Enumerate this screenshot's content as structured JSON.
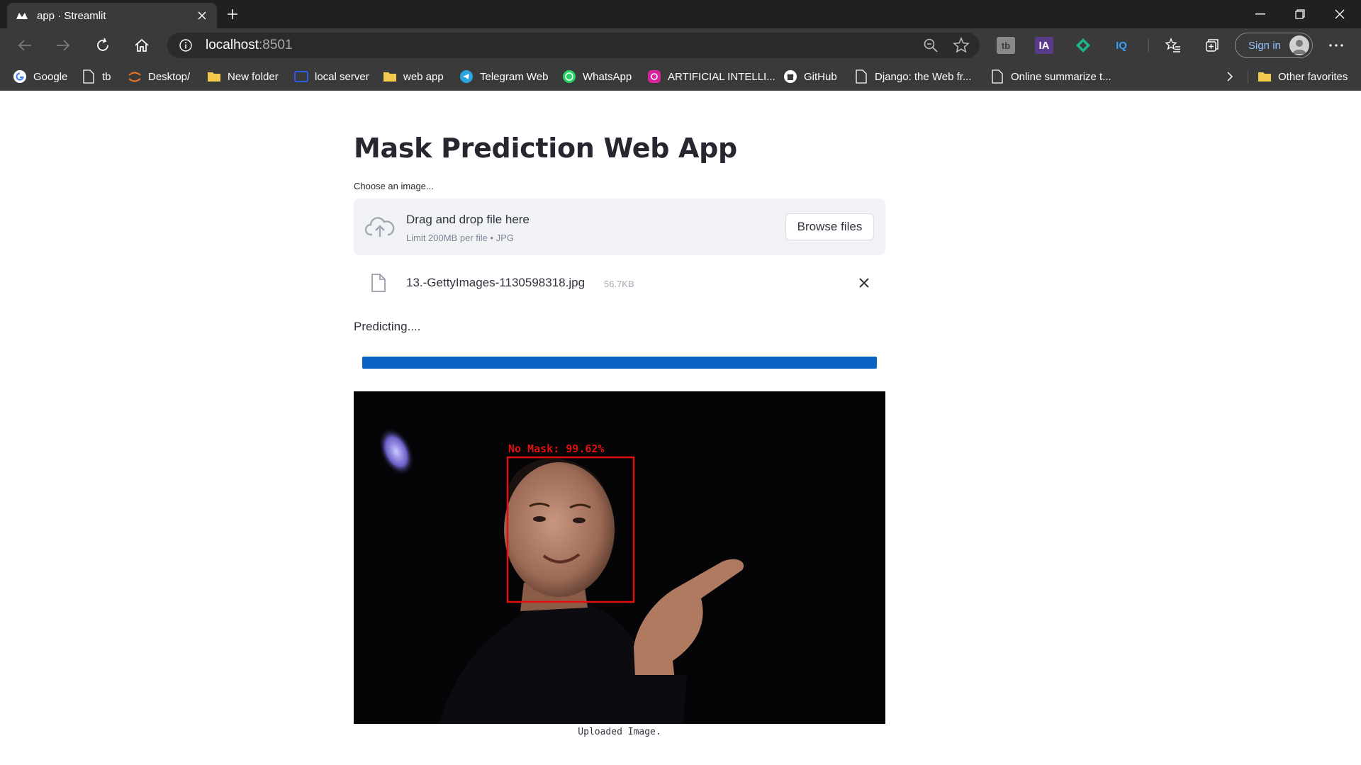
{
  "browser": {
    "tab_title": "app · Streamlit",
    "url_host": "localhost",
    "url_port": ":8501",
    "signin_label": "Sign in",
    "extensions": [
      "tb",
      "IA",
      "IQ"
    ],
    "bookmarks": [
      {
        "label": "Google",
        "icon": "google-icon"
      },
      {
        "label": "tb",
        "icon": "page-icon"
      },
      {
        "label": "Desktop/",
        "icon": "jupyter-icon"
      },
      {
        "label": "New folder",
        "icon": "folder-icon"
      },
      {
        "label": "local server",
        "icon": "server-icon"
      },
      {
        "label": "web app",
        "icon": "folder-icon"
      },
      {
        "label": "Telegram Web",
        "icon": "telegram-icon"
      },
      {
        "label": "WhatsApp",
        "icon": "whatsapp-icon"
      },
      {
        "label": "ARTIFICIAL INTELLI...",
        "icon": "instagram-icon"
      },
      {
        "label": "GitHub",
        "icon": "github-icon"
      },
      {
        "label": "Django: the Web fr...",
        "icon": "page-icon"
      },
      {
        "label": "Online summarize t...",
        "icon": "page-icon"
      }
    ],
    "other_favorites": "Other favorites"
  },
  "app": {
    "title": "Mask Prediction Web App",
    "uploader_label": "Choose an image...",
    "drop_text": "Drag and drop file here",
    "limit_text": "Limit 200MB per file • JPG",
    "browse_label": "Browse files",
    "file_name": "13.-GettyImages-1130598318.jpg",
    "file_size": "56.7KB",
    "status_text": "Predicting....",
    "progress": 1.0,
    "detection_label": "No Mask: 99.62%",
    "image_caption": "Uploaded Image."
  },
  "colors": {
    "progress": "#0b63c4",
    "detection_box": "#e01010",
    "chrome_dark": "#202020",
    "chrome": "#3a3a3a"
  }
}
